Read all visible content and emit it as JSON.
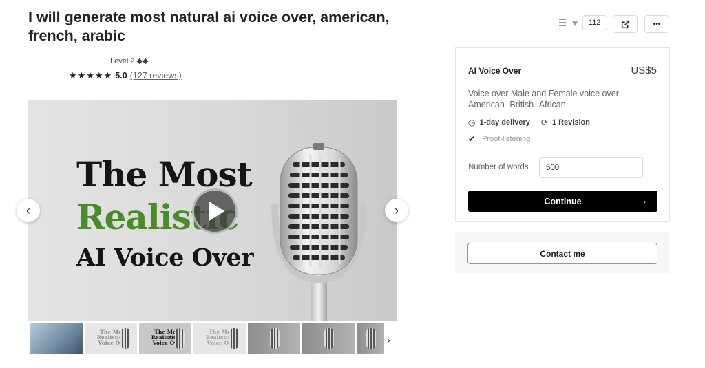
{
  "gig": {
    "title": "I will generate most natural ai voice over, american, french, arabic",
    "level": "Level 2 ◆◆",
    "stars": "★★★★★",
    "rating": "5.0",
    "reviews": "(127 reviews)",
    "likes_count": "112"
  },
  "media": {
    "headline_line1": "The Most",
    "headline_line2": "Realistic",
    "headline_line3": "AI Voice Over",
    "headline_color": "#4a8a2a"
  },
  "thumbnails": [
    {
      "type": "person",
      "text": ""
    },
    {
      "type": "light",
      "text": "The Most Realistic AI Voice Over"
    },
    {
      "type": "dark",
      "text": "The Most Realistic AI Voice Over"
    },
    {
      "type": "light",
      "text": "The Most Realistic AI Voice Over"
    },
    {
      "type": "grey",
      "text": ""
    },
    {
      "type": "grey",
      "text": ""
    },
    {
      "type": "grey",
      "text": ""
    }
  ],
  "package": {
    "name": "AI Voice Over",
    "price": "US$5",
    "description": "Voice over Male and Female voice over -American -British -African",
    "delivery": "1-day delivery",
    "revisions": "1 Revision",
    "feature": "Proof-listening",
    "words_label": "Number of words",
    "words_value": "500",
    "continue_label": "Continue"
  },
  "contact": {
    "label": "Contact me"
  },
  "icons": {
    "list": "☰",
    "heart": "♥",
    "share": "⇪",
    "more": "•••",
    "prev": "‹",
    "next": "›",
    "clock": "◷",
    "revision": "⟳",
    "check": "✔",
    "arrow": "→"
  },
  "colors": {
    "accent_green": "#4a8a2a",
    "button_black": "#000000"
  }
}
